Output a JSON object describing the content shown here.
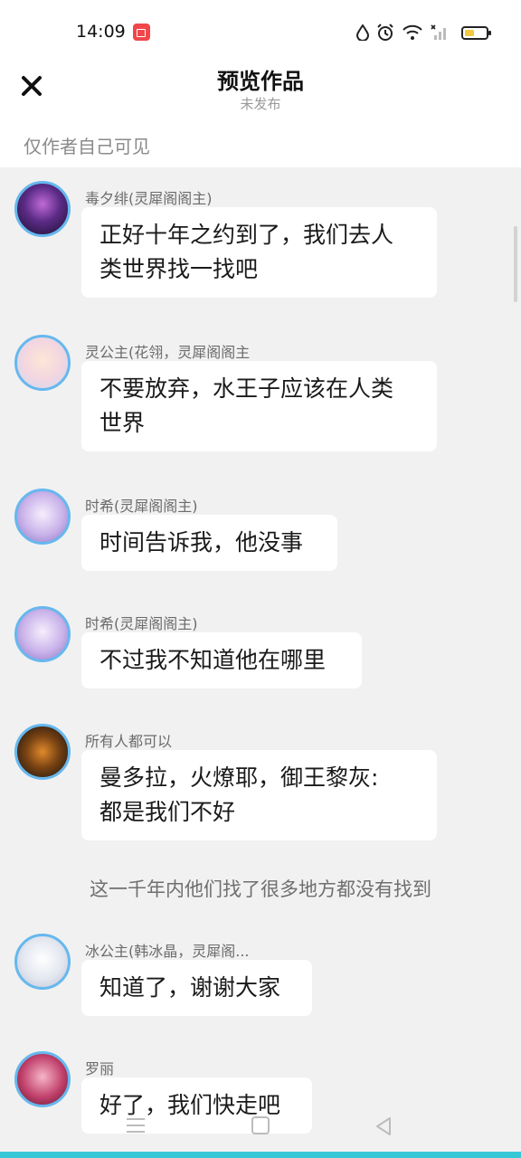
{
  "status_bar": {
    "time": "14:09",
    "icons": [
      "screen-record-icon",
      "water-drop-icon",
      "alarm-clock-icon",
      "wifi-icon",
      "no-signal-icon",
      "battery-icon"
    ],
    "battery_color": "#f5c842"
  },
  "header": {
    "close_icon": "close-icon",
    "title": "预览作品",
    "subtitle": "未发布",
    "visibility_note": "仅作者自己可见"
  },
  "messages": [
    {
      "sender": "毒夕绯(灵犀阁阁主)",
      "text_lines": [
        "正好十年之约到了，我们去人",
        "类世界找一找吧"
      ]
    },
    {
      "sender": "灵公主(花翎，灵犀阁阁主",
      "text_lines": [
        "不要放弃，水王子应该在人类",
        "世界"
      ]
    },
    {
      "sender": "时希(灵犀阁阁主)",
      "text_lines": [
        "时间告诉我，他没事"
      ]
    },
    {
      "sender": "时希(灵犀阁阁主)",
      "text_lines": [
        "不过我不知道他在哪里"
      ]
    },
    {
      "sender": "所有人都可以",
      "text_lines": [
        "曼多拉，火燎耶，御王黎灰:",
        "都是我们不好"
      ]
    },
    {
      "sender": "冰公主(韩冰晶，灵犀阁...",
      "text_lines": [
        "知道了，谢谢大家"
      ]
    },
    {
      "sender": "罗丽",
      "text_lines": [
        "好了，我们快走吧"
      ]
    }
  ],
  "narration": "这一千年内他们找了很多地方都没有找到",
  "nav": {
    "icons": [
      "menu-icon",
      "home-icon",
      "back-icon"
    ]
  },
  "colors": {
    "accent": "#37c8d8",
    "avatar_border": "#66b8ee",
    "record": "#f0474b"
  }
}
